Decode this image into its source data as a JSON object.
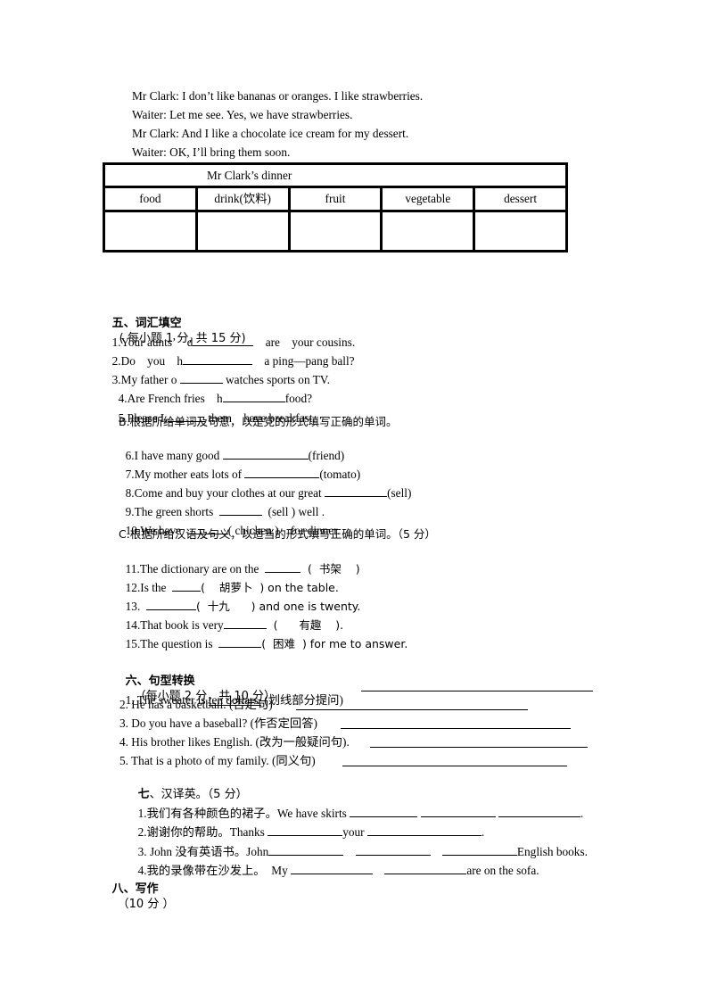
{
  "dialogue": [
    "Mr Clark: I don’t like bananas or oranges. I like strawberries.",
    "Waiter: Let me see. Yes, we have strawberries.",
    "Mr Clark: And I like a chocolate ice cream for my dessert.",
    "Waiter: OK, I’ll bring them soon."
  ],
  "dinner_table": {
    "title": "Mr Clark’s dinner",
    "columns": [
      "food",
      "drink(饮料)",
      "fruit",
      "vegetable",
      "dessert"
    ],
    "values": [
      "",
      "",
      "",
      "",
      ""
    ]
  },
  "section5": {
    "heading": "五、词汇填空",
    "note": "( 每小题 1 分, 共 15 分)",
    "partA": [
      {
        "pre": "1.Your aunts’    d",
        "post": "    are    your cousins."
      },
      {
        "pre": "2.Do    you    h",
        "post": "    a ping—pang ball?"
      },
      {
        "pre": "3.My father o ",
        "post": " watches sports on TV."
      },
      {
        "pre": "4.Are French fries    h",
        "post": "food?"
      },
      {
        "pre": "5.Please L",
        "post": " them    have breakfast."
      }
    ],
    "partB_heading": "B.根据所给单词及句意，以是党的形式填写正确的单词。",
    "partB": [
      {
        "pre": "6.I have many good ",
        "post": "(friend)"
      },
      {
        "pre": "7.My mother eats lots of ",
        "post": "(tomato)"
      },
      {
        "pre": "8.Come and buy your clothes at our great ",
        "post": "(sell)"
      },
      {
        "pre": "9.The green shorts  ",
        "post": "  (sell ) well ."
      },
      {
        "pre": "10.We have  ",
        "post": "( chicken )    for dinner."
      }
    ],
    "partC_heading": "C.根据所给汉语及句义，以适当的形式填写正确的单词。（5 分）",
    "partC": [
      {
        "pre": "11.The dictionary are on the  ",
        "post": "  (  书架    )"
      },
      {
        "pre": "12.Is the  ",
        "post": "(    胡萝卜  ) on the table."
      },
      {
        "pre": "13.  ",
        "post": "(  十九      ) and one is twenty."
      },
      {
        "pre": "14.That book is very",
        "post": "  (      有趣    )."
      },
      {
        "pre": "15.The question is  ",
        "post": "(  困难  ) for me to answer."
      }
    ]
  },
  "section6": {
    "heading": "六、句型转换",
    "note": "（每小题 2 分，共 10 分）",
    "items": [
      {
        "pre": "1. The sweater is ",
        "underlined": "ten dollars.",
        "post": " (划线部分提问)"
      },
      {
        "pre": "2. He has a basketball. (否定句)",
        "underlined": "",
        "post": ""
      },
      {
        "pre": "3. Do you have a baseball? (作否定回答)",
        "underlined": "",
        "post": ""
      },
      {
        "pre": "4. His brother likes English. (改为一般疑问句).",
        "underlined": "",
        "post": ""
      },
      {
        "pre": "5. That is a photo of my family. (同义句)",
        "underlined": "",
        "post": ""
      }
    ]
  },
  "section7": {
    "heading": "七",
    "note": "、汉译英。（5 分）",
    "items": [
      {
        "text1": "1.我们有各种颜色的裙子。We have skirts ",
        "text2": "",
        "text3": "",
        "end": "."
      },
      {
        "text1": "2.谢谢你的帮助。Thanks ",
        "text2": "your ",
        "text3": "",
        "end": "."
      },
      {
        "text1": "3. John 没有英语书。John",
        "text2": "",
        "text3": "",
        "end": "English books."
      },
      {
        "text1": "4.我的录像带在沙发上。  My ",
        "text2": "",
        "text3": "",
        "end": "are on the sofa."
      }
    ]
  },
  "section8": {
    "heading": "八、写作",
    "note": "（10 分 ）"
  }
}
